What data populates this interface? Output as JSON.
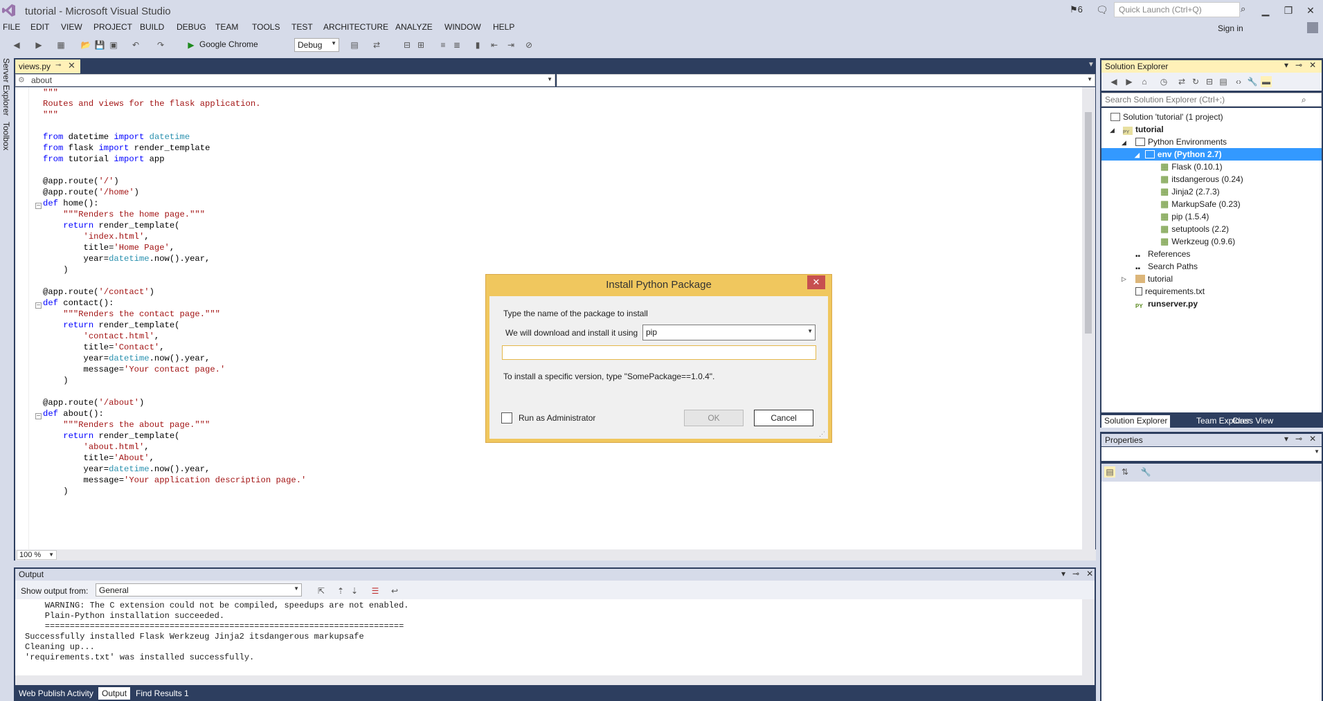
{
  "window": {
    "title": "tutorial - Microsoft Visual Studio",
    "notification_count": "6",
    "quick_launch_placeholder": "Quick Launch (Ctrl+Q)",
    "sign_in": "Sign in"
  },
  "menu": [
    "FILE",
    "EDIT",
    "VIEW",
    "PROJECT",
    "BUILD",
    "DEBUG",
    "TEAM",
    "TOOLS",
    "TEST",
    "ARCHITECTURE",
    "ANALYZE",
    "WINDOW",
    "HELP"
  ],
  "toolbar": {
    "run_target": "Google Chrome",
    "configuration": "Debug"
  },
  "side_tabs": [
    "Server Explorer",
    "Toolbox"
  ],
  "editor": {
    "tab_label": "views.py",
    "nav_member": "about",
    "zoom": "100 %"
  },
  "output": {
    "title": "Output",
    "show_from_label": "Show output from:",
    "source": "General",
    "text": "    WARNING: The C extension could not be compiled, speedups are not enabled.\n    Plain-Python installation succeeded.\n    ========================================================================\nSuccessfully installed Flask Werkzeug Jinja2 itsdangerous markupsafe\nCleaning up...\n'requirements.txt' was installed successfully."
  },
  "bottom_tabs": [
    "Web Publish Activity",
    "Output",
    "Find Results 1"
  ],
  "solution_explorer": {
    "title": "Solution Explorer",
    "search_placeholder": "Search Solution Explorer (Ctrl+;)",
    "items": [
      {
        "label": "Solution 'tutorial' (1 project)"
      },
      {
        "label": "tutorial"
      },
      {
        "label": "Python Environments"
      },
      {
        "label": "env (Python 2.7)"
      },
      {
        "label": "Flask (0.10.1)"
      },
      {
        "label": "itsdangerous (0.24)"
      },
      {
        "label": "Jinja2 (2.7.3)"
      },
      {
        "label": "MarkupSafe (0.23)"
      },
      {
        "label": "pip (1.5.4)"
      },
      {
        "label": "setuptools (2.2)"
      },
      {
        "label": "Werkzeug (0.9.6)"
      },
      {
        "label": "References"
      },
      {
        "label": "Search Paths"
      },
      {
        "label": "tutorial"
      },
      {
        "label": "requirements.txt"
      },
      {
        "label": "runserver.py"
      }
    ],
    "tabs": [
      "Solution Explorer",
      "Team Explorer",
      "Class View"
    ]
  },
  "properties": {
    "title": "Properties"
  },
  "dialog": {
    "title": "Install Python Package",
    "prompt": "Type the name of the package to install",
    "using_label": "We will download and install it using",
    "installer": "pip",
    "package_value": "",
    "hint": "To install a specific version, type \"SomePackage==1.0.4\".",
    "admin_label": "Run as Administrator",
    "ok_label": "OK",
    "cancel_label": "Cancel"
  }
}
